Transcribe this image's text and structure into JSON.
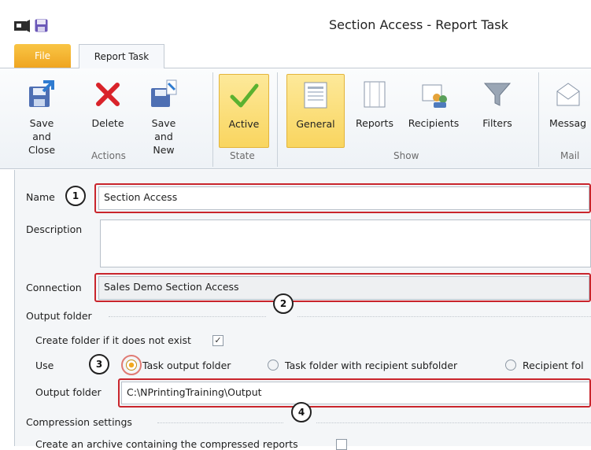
{
  "window": {
    "title": "Section Access - Report Task"
  },
  "tabs": [
    {
      "label": "File"
    },
    {
      "label": "Report Task"
    }
  ],
  "ribbon": {
    "buttons": [
      {
        "label": "Save and\nClose",
        "icon": "save-close-icon"
      },
      {
        "label": "Delete",
        "icon": "delete-icon"
      },
      {
        "label": "Save and\nNew",
        "icon": "save-new-icon"
      },
      {
        "label": "Active",
        "icon": "checkmark-icon",
        "selected": true
      },
      {
        "label": "General",
        "icon": "general-icon",
        "selected": true
      },
      {
        "label": "Reports",
        "icon": "reports-icon"
      },
      {
        "label": "Recipients",
        "icon": "recipients-icon"
      },
      {
        "label": "Filters",
        "icon": "filter-icon"
      },
      {
        "label": "Messag",
        "icon": "message-icon"
      }
    ],
    "groups": [
      "Actions",
      "State",
      "Show",
      "Mail"
    ]
  },
  "form": {
    "name_label": "Name",
    "name_value": "Section Access",
    "description_label": "Description",
    "description_value": "",
    "connection_label": "Connection",
    "connection_value": "Sales Demo Section Access",
    "output_folder_section": "Output folder",
    "create_folder_label": "Create folder if it does not exist",
    "create_folder_checked": true,
    "use_label": "Use",
    "use_options": [
      "Task output folder",
      "Task folder with recipient subfolder",
      "Recipient fol"
    ],
    "use_selected": "Task output folder",
    "output_folder_label": "Output  folder",
    "output_folder_value": "C:\\NPrintingTraining\\Output",
    "compression_section": "Compression settings",
    "archive_label": "Create an archive containing the compressed reports"
  },
  "callouts": [
    "1",
    "2",
    "3",
    "4"
  ],
  "colors": {
    "file_tab": "#f0a623",
    "highlight": "#fbde7b",
    "annotation_red": "#c9252c"
  }
}
